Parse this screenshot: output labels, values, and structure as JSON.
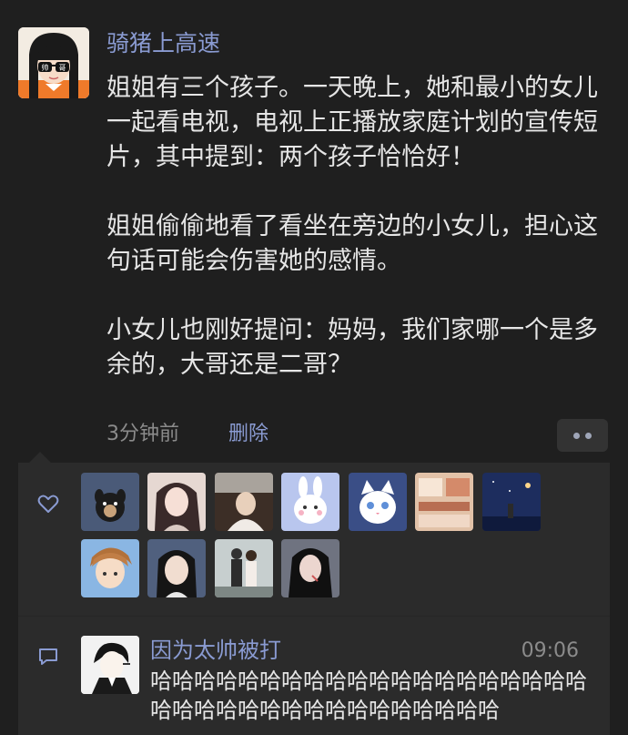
{
  "post": {
    "username": "骑猪上高速",
    "avatar_text": [
      "帅",
      "哥"
    ],
    "paragraphs": [
      "姐姐有三个孩子。一天晚上，她和最小的女儿一起看电视，电视上正播放家庭计划的宣传短片，其中提到：两个孩子恰恰好！",
      "姐姐偷偷地看了看坐在旁边的小女儿，担心这句话可能会伤害她的感情。",
      "小女儿也刚好提问：妈妈，我们家哪一个是多余的，大哥还是二哥？"
    ],
    "time": "3分钟前",
    "delete_label": "删除"
  },
  "likes": {
    "icon": "heart-icon",
    "avatars": [
      {
        "name": "like-avatar-dog",
        "bg": "#4a5a78"
      },
      {
        "name": "like-avatar-girl-1",
        "bg": "#d8c4bc"
      },
      {
        "name": "like-avatar-car",
        "bg": "#6b5040"
      },
      {
        "name": "like-avatar-bunny",
        "bg": "#b9c6ee"
      },
      {
        "name": "like-avatar-cat",
        "bg": "#3a4e86"
      },
      {
        "name": "like-avatar-room",
        "bg": "#c9a08a"
      },
      {
        "name": "like-avatar-night",
        "bg": "#1d2d5e"
      },
      {
        "name": "like-avatar-anime-boy",
        "bg": "#8ab6e3"
      },
      {
        "name": "like-avatar-anime-girl",
        "bg": "#50607e"
      },
      {
        "name": "like-avatar-couple",
        "bg": "#9aa6a8"
      },
      {
        "name": "like-avatar-girl-2",
        "bg": "#7b7f8a"
      }
    ]
  },
  "comments": [
    {
      "name": "因为太帅被打",
      "time": "09:06",
      "text": "哈哈哈哈哈哈哈哈哈哈哈哈哈哈哈哈哈哈哈哈哈哈哈哈哈哈哈哈哈哈哈哈哈哈哈哈"
    }
  ],
  "colors": {
    "background": "#1f1f1f",
    "panel": "#2b2b2b",
    "name_link": "#8a9bd2",
    "text": "#e6e6e6",
    "muted": "#8b8b8b"
  }
}
